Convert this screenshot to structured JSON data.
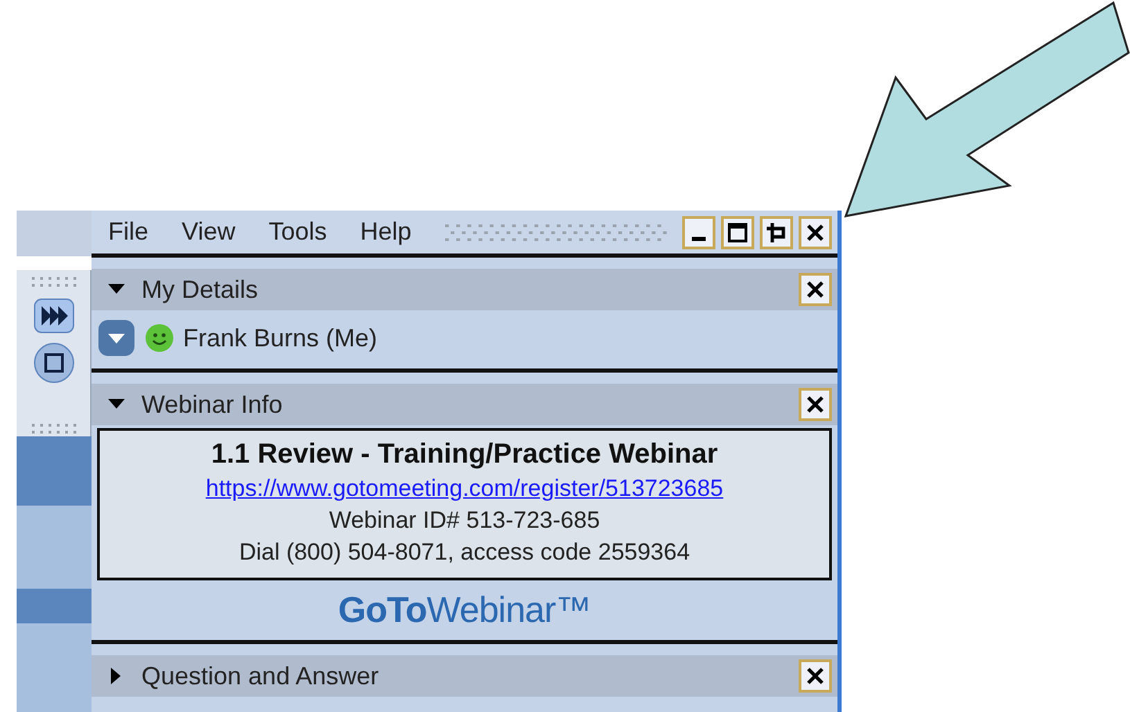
{
  "menu": [
    "File",
    "View",
    "Tools",
    "Help"
  ],
  "sections": [
    {
      "kind": "details",
      "title": "My Details",
      "expanded": true,
      "attendee": "Frank Burns (Me)"
    },
    {
      "kind": "info",
      "title": "Webinar Info",
      "expanded": true,
      "webinar_title": "1.1 Review - Training/Practice Webinar",
      "link": "https://www.gotomeeting.com/register/513723685",
      "webinar_id": "Webinar ID# 513-723-685",
      "dial": "Dial (800) 504-8071, access code 2559364",
      "logo": "**GoTo**Webinar™"
    },
    {
      "kind": "qa",
      "title": "Question and Answer",
      "expanded": false
    }
  ]
}
